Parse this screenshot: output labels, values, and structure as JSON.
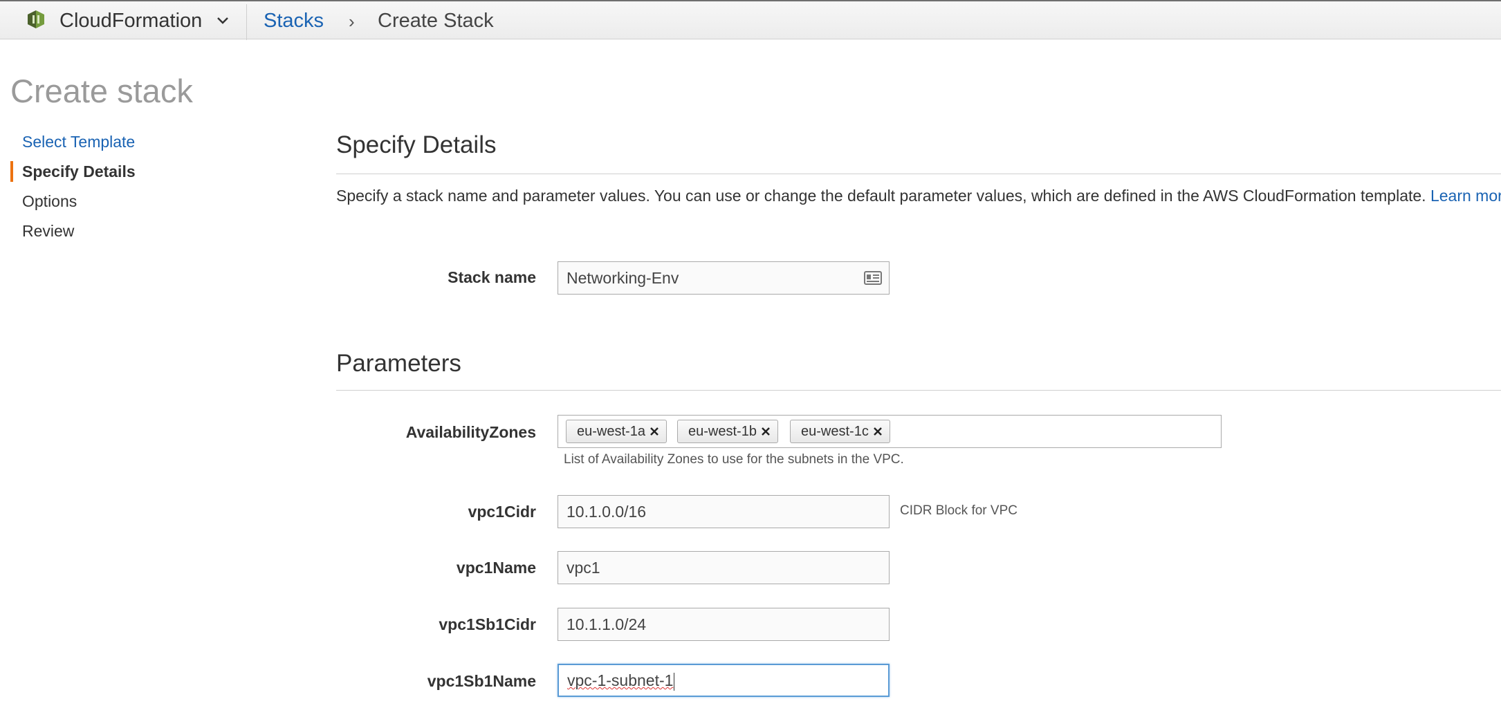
{
  "topbar": {
    "service": "CloudFormation",
    "breadcrumb_link": "Stacks",
    "breadcrumb_sep": "›",
    "breadcrumb_current": "Create Stack"
  },
  "page": {
    "title": "Create stack"
  },
  "steps": [
    {
      "label": "Select Template",
      "state": "link"
    },
    {
      "label": "Specify Details",
      "state": "active"
    },
    {
      "label": "Options",
      "state": "plain"
    },
    {
      "label": "Review",
      "state": "plain"
    }
  ],
  "details": {
    "heading": "Specify Details",
    "intro": "Specify a stack name and parameter values. You can use or change the default parameter values, which are defined in the AWS CloudFormation template.",
    "learn_more": "Learn more.",
    "stack_name_label": "Stack name",
    "stack_name_value": "Networking-Env"
  },
  "parameters": {
    "heading": "Parameters",
    "az_label": "AvailabilityZones",
    "az_tags": [
      "eu-west-1a",
      "eu-west-1b",
      "eu-west-1c"
    ],
    "az_help": "List of Availability Zones to use for the subnets in the VPC.",
    "fields": [
      {
        "label": "vpc1Cidr",
        "value": "10.1.0.0/16",
        "help": "CIDR Block for VPC"
      },
      {
        "label": "vpc1Name",
        "value": "vpc1",
        "help": ""
      },
      {
        "label": "vpc1Sb1Cidr",
        "value": "10.1.1.0/24",
        "help": ""
      },
      {
        "label": "vpc1Sb1Name",
        "value": "vpc-1-subnet-1",
        "help": ""
      }
    ]
  },
  "colors": {
    "link": "#1a63b3",
    "active_step_accent": "#ec7211",
    "focus_border": "#5a9bd5"
  }
}
